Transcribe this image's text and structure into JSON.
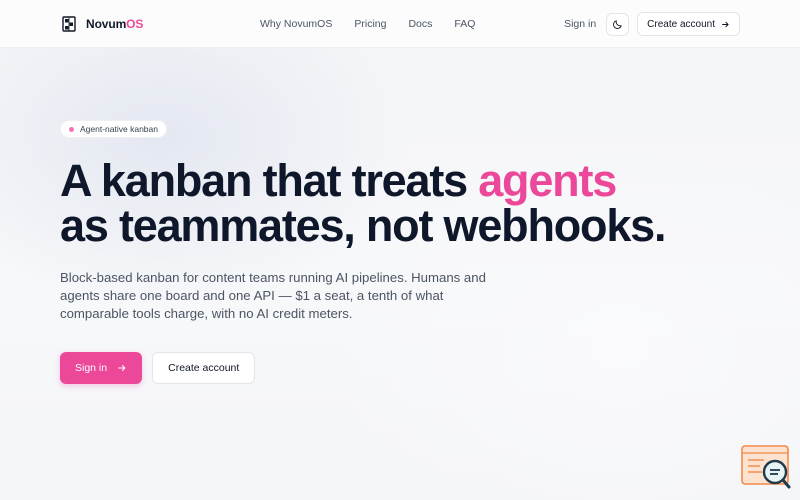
{
  "brand": {
    "name_main": "Novum",
    "name_accent": "OS"
  },
  "nav": {
    "links": [
      "Why NovumOS",
      "Pricing",
      "Docs",
      "FAQ"
    ],
    "sign_in": "Sign in",
    "create_account": "Create account"
  },
  "hero": {
    "badge": "Agent-native kanban",
    "headline_part1": "A kanban that treats ",
    "headline_accent": "agents",
    "headline_part2": "as teammates, not webhooks.",
    "subtext": "Block-based kanban for content teams running AI pipelines. Humans and agents share one board and one API — $1 a seat, a tenth of what comparable tools charge, with no AI credit meters.",
    "primary_cta": "Sign in",
    "secondary_cta": "Create account"
  },
  "colors": {
    "accent": "#ec4899",
    "text_dark": "#0f172a",
    "text_muted": "#4b5563",
    "background": "#f5f6f8"
  },
  "icons": {
    "brand": "novum-logo-icon",
    "theme": "moon-icon",
    "arrow": "arrow-right-icon",
    "widget": "search-widget-icon"
  }
}
